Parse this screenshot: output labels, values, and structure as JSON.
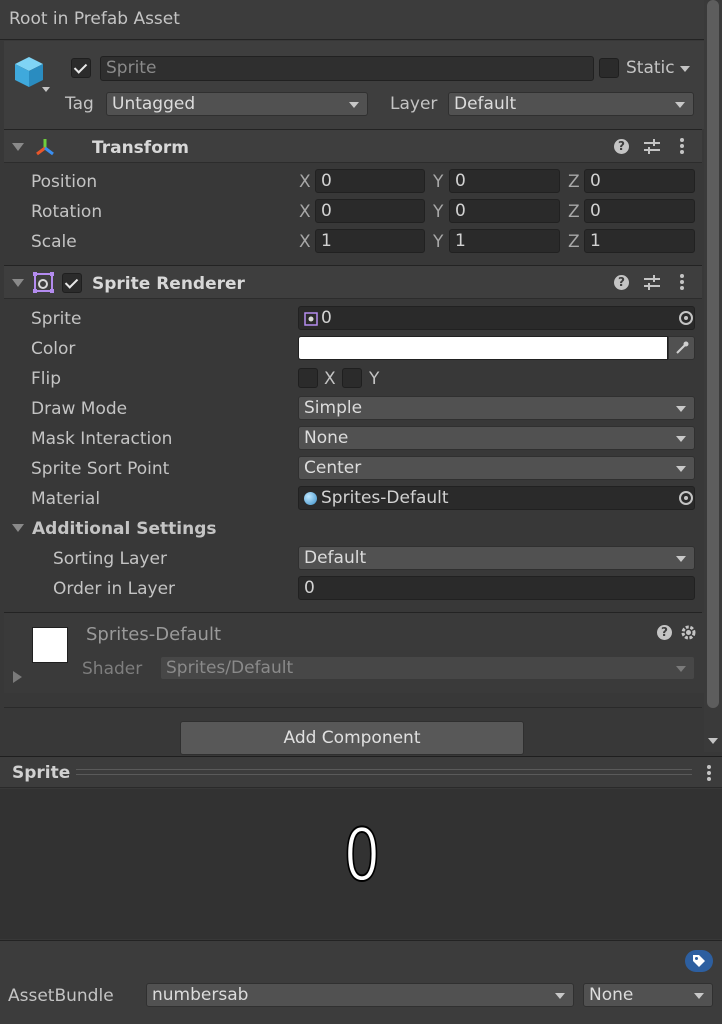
{
  "window": {
    "title": "Root in Prefab Asset"
  },
  "object": {
    "active_checked": true,
    "name": "Sprite",
    "static_label": "Static",
    "tag_label": "Tag",
    "tag_value": "Untagged",
    "layer_label": "Layer",
    "layer_value": "Default"
  },
  "transform": {
    "title": "Transform",
    "rows": [
      {
        "label": "Position",
        "x": "0",
        "y": "0",
        "z": "0"
      },
      {
        "label": "Rotation",
        "x": "0",
        "y": "0",
        "z": "0"
      },
      {
        "label": "Scale",
        "x": "1",
        "y": "1",
        "z": "1"
      }
    ],
    "axis_x": "X",
    "axis_y": "Y",
    "axis_z": "Z"
  },
  "sprite_renderer": {
    "title": "Sprite Renderer",
    "enabled": true,
    "sprite_label": "Sprite",
    "sprite_value": "0",
    "color_label": "Color",
    "color_value": "#ffffff",
    "flip_label": "Flip",
    "flip_x": "X",
    "flip_y": "Y",
    "draw_mode_label": "Draw Mode",
    "draw_mode_value": "Simple",
    "mask_label": "Mask Interaction",
    "mask_value": "None",
    "sort_point_label": "Sprite Sort Point",
    "sort_point_value": "Center",
    "material_label": "Material",
    "material_value": "Sprites-Default",
    "additional_label": "Additional Settings",
    "sorting_layer_label": "Sorting Layer",
    "sorting_layer_value": "Default",
    "order_label": "Order in Layer",
    "order_value": "0"
  },
  "material": {
    "name": "Sprites-Default",
    "shader_label": "Shader",
    "shader_value": "Sprites/Default"
  },
  "add_component_label": "Add Component",
  "preview": {
    "title": "Sprite",
    "glyph": "0"
  },
  "asset_bundle": {
    "label": "AssetBundle",
    "value": "numbersab",
    "variant": "None"
  },
  "colors": {
    "panel": "#383838",
    "header": "#3e3e3e",
    "field": "#2a2a2a",
    "accent_blue": "#2d5fa0"
  }
}
